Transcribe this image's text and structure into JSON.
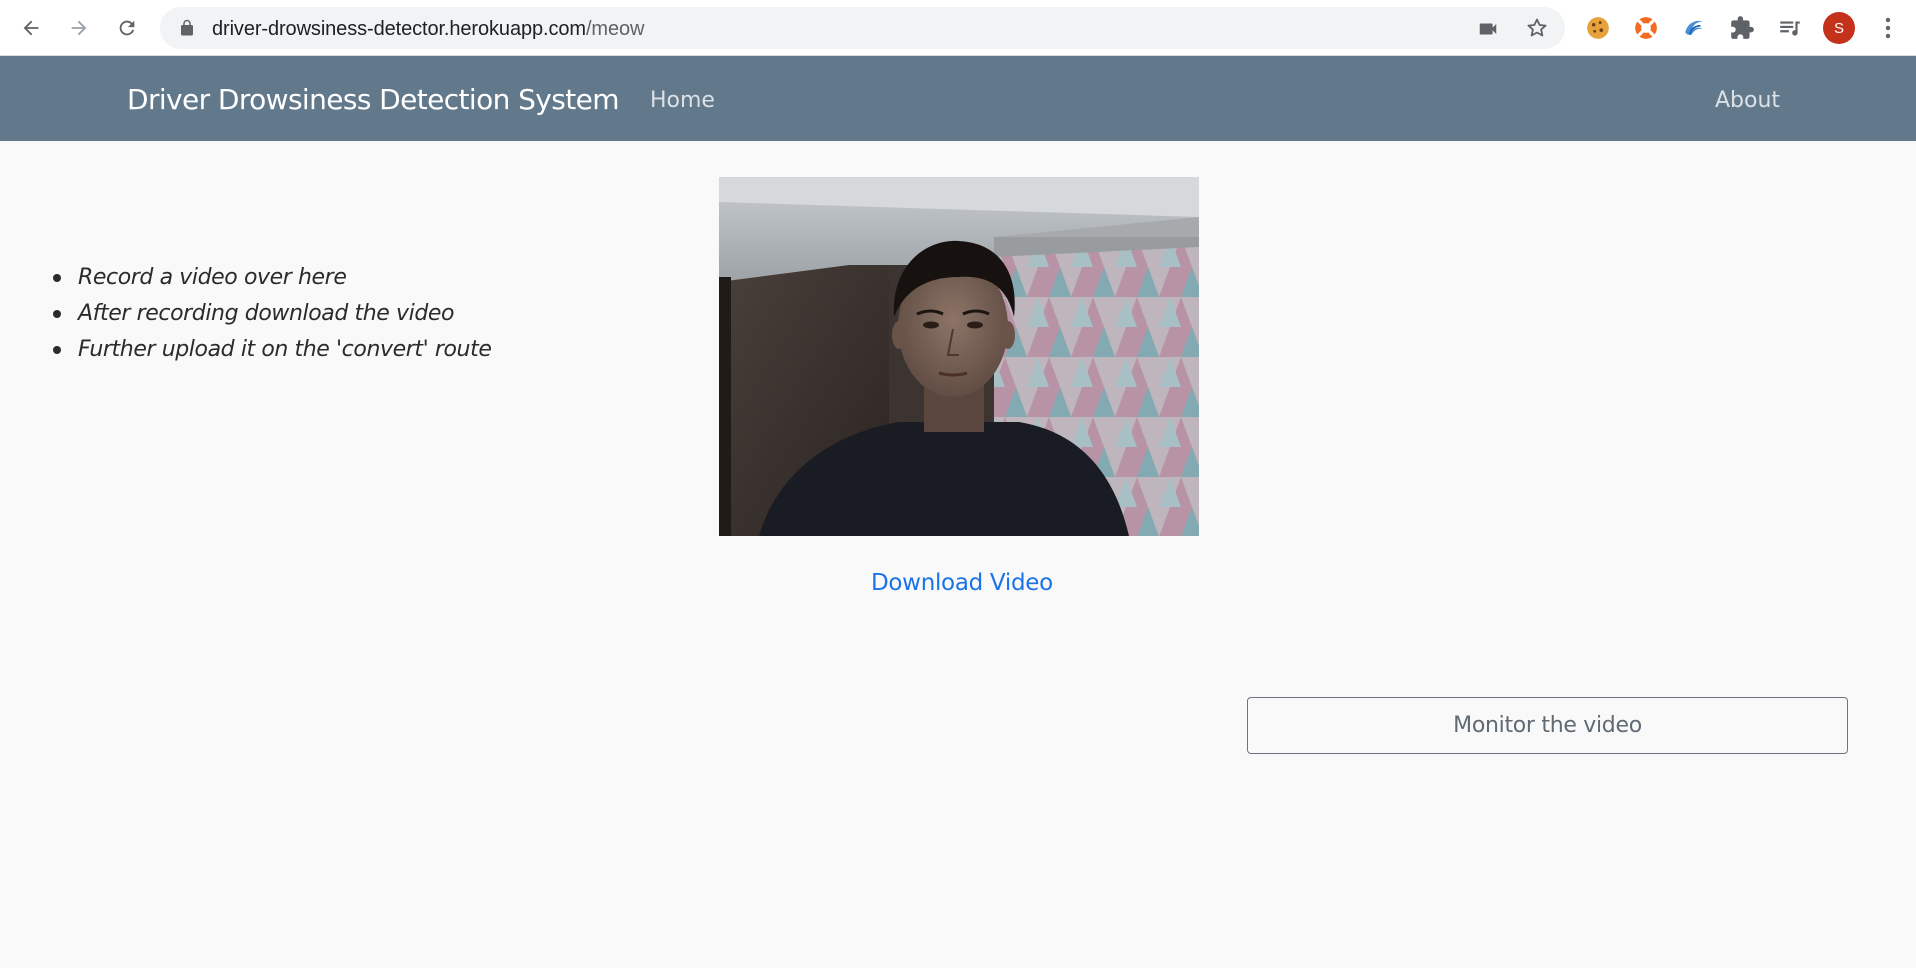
{
  "browser": {
    "url_host": "driver-drowsiness-detector.herokuapp.com",
    "url_path": "/meow",
    "profile_initial": "S"
  },
  "navbar": {
    "brand": "Driver Drowsiness Detection System",
    "home": "Home",
    "about": "About"
  },
  "instructions": [
    "Record a video over here",
    "After recording download the video",
    "Further upload it on the 'convert' route"
  ],
  "download_label": "Download Video",
  "monitor_label": "Monitor the video",
  "colors": {
    "navbar": "#62788b",
    "link": "#1a73e8",
    "background": "#f9f9f9",
    "button_border": "#6c757d"
  }
}
